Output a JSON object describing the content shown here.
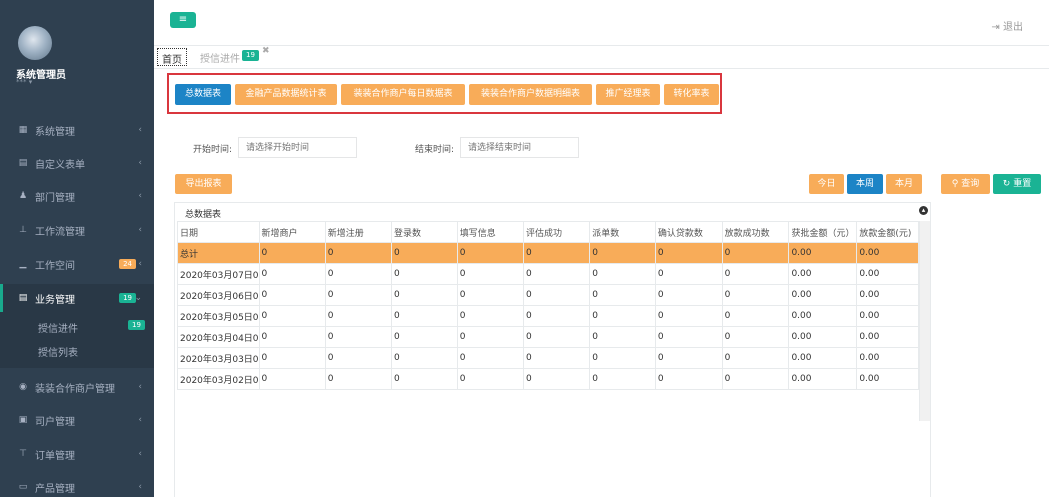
{
  "user": {
    "name": "系统管理员",
    "role": "***"
  },
  "sidebar": {
    "items": [
      {
        "label": "系统管理",
        "icon": "grid-icon"
      },
      {
        "label": "自定义表单",
        "icon": "form-icon"
      },
      {
        "label": "部门管理",
        "icon": "users-icon"
      },
      {
        "label": "工作流管理",
        "icon": "sitemap-icon"
      },
      {
        "label": "工作空间",
        "icon": "desk-icon",
        "badge": "24"
      },
      {
        "label": "业务管理",
        "icon": "list-icon",
        "badge": "19"
      },
      {
        "label": "装装合作商户管理",
        "icon": "car-icon"
      },
      {
        "label": "司户管理",
        "icon": "card-icon"
      },
      {
        "label": "订单管理",
        "icon": "cart-icon"
      },
      {
        "label": "产品管理",
        "icon": "product-icon"
      }
    ],
    "submenu": [
      {
        "label": "授信进件",
        "badge": "19"
      },
      {
        "label": "授信列表"
      }
    ]
  },
  "header": {
    "logout_label": "退出"
  },
  "tabs": {
    "home": "首页",
    "task": "授信进件",
    "task_badge": "19"
  },
  "report_buttons": [
    "总数据表",
    "金融产品数据统计表",
    "装装合作商户每日数据表",
    "装装合作商户数据明细表",
    "推广经理表",
    "转化率表"
  ],
  "filters": {
    "start_label": "开始时间:",
    "start_placeholder": "请选择开始时间",
    "end_label": "结束时间:",
    "end_placeholder": "请选择结束时间"
  },
  "actions": {
    "export": "导出报表",
    "today": "今日",
    "this_week": "本周",
    "this_month": "本月",
    "query": "查询",
    "reset": "重置"
  },
  "table": {
    "title": "总数据表",
    "columns": [
      "日期",
      "新增商户",
      "新增注册",
      "登录数",
      "填写信息",
      "评估成功",
      "派单数",
      "确认贷款数",
      "放款成功数",
      "获批金额（元）",
      "放款金额(元)"
    ],
    "rows": [
      [
        "总计",
        "0",
        "0",
        "0",
        "0",
        "0",
        "0",
        "0",
        "0",
        "0.00",
        "0.00"
      ],
      [
        "2020年03月07日0",
        "0",
        "0",
        "0",
        "0",
        "0",
        "0",
        "0",
        "0",
        "0.00",
        "0.00"
      ],
      [
        "2020年03月06日0",
        "0",
        "0",
        "0",
        "0",
        "0",
        "0",
        "0",
        "0",
        "0.00",
        "0.00"
      ],
      [
        "2020年03月05日0",
        "0",
        "0",
        "0",
        "0",
        "0",
        "0",
        "0",
        "0",
        "0.00",
        "0.00"
      ],
      [
        "2020年03月04日0",
        "0",
        "0",
        "0",
        "0",
        "0",
        "0",
        "0",
        "0",
        "0.00",
        "0.00"
      ],
      [
        "2020年03月03日0",
        "0",
        "0",
        "0",
        "0",
        "0",
        "0",
        "0",
        "0",
        "0.00",
        "0.00"
      ],
      [
        "2020年03月02日0",
        "0",
        "0",
        "0",
        "0",
        "0",
        "0",
        "0",
        "0",
        "0.00",
        "0.00"
      ]
    ]
  },
  "colors": {
    "sidebar": "#2f4050",
    "primary": "#1c84c6",
    "orange": "#f8ac59",
    "teal": "#1ab394",
    "highlight_border": "#d9363e"
  }
}
